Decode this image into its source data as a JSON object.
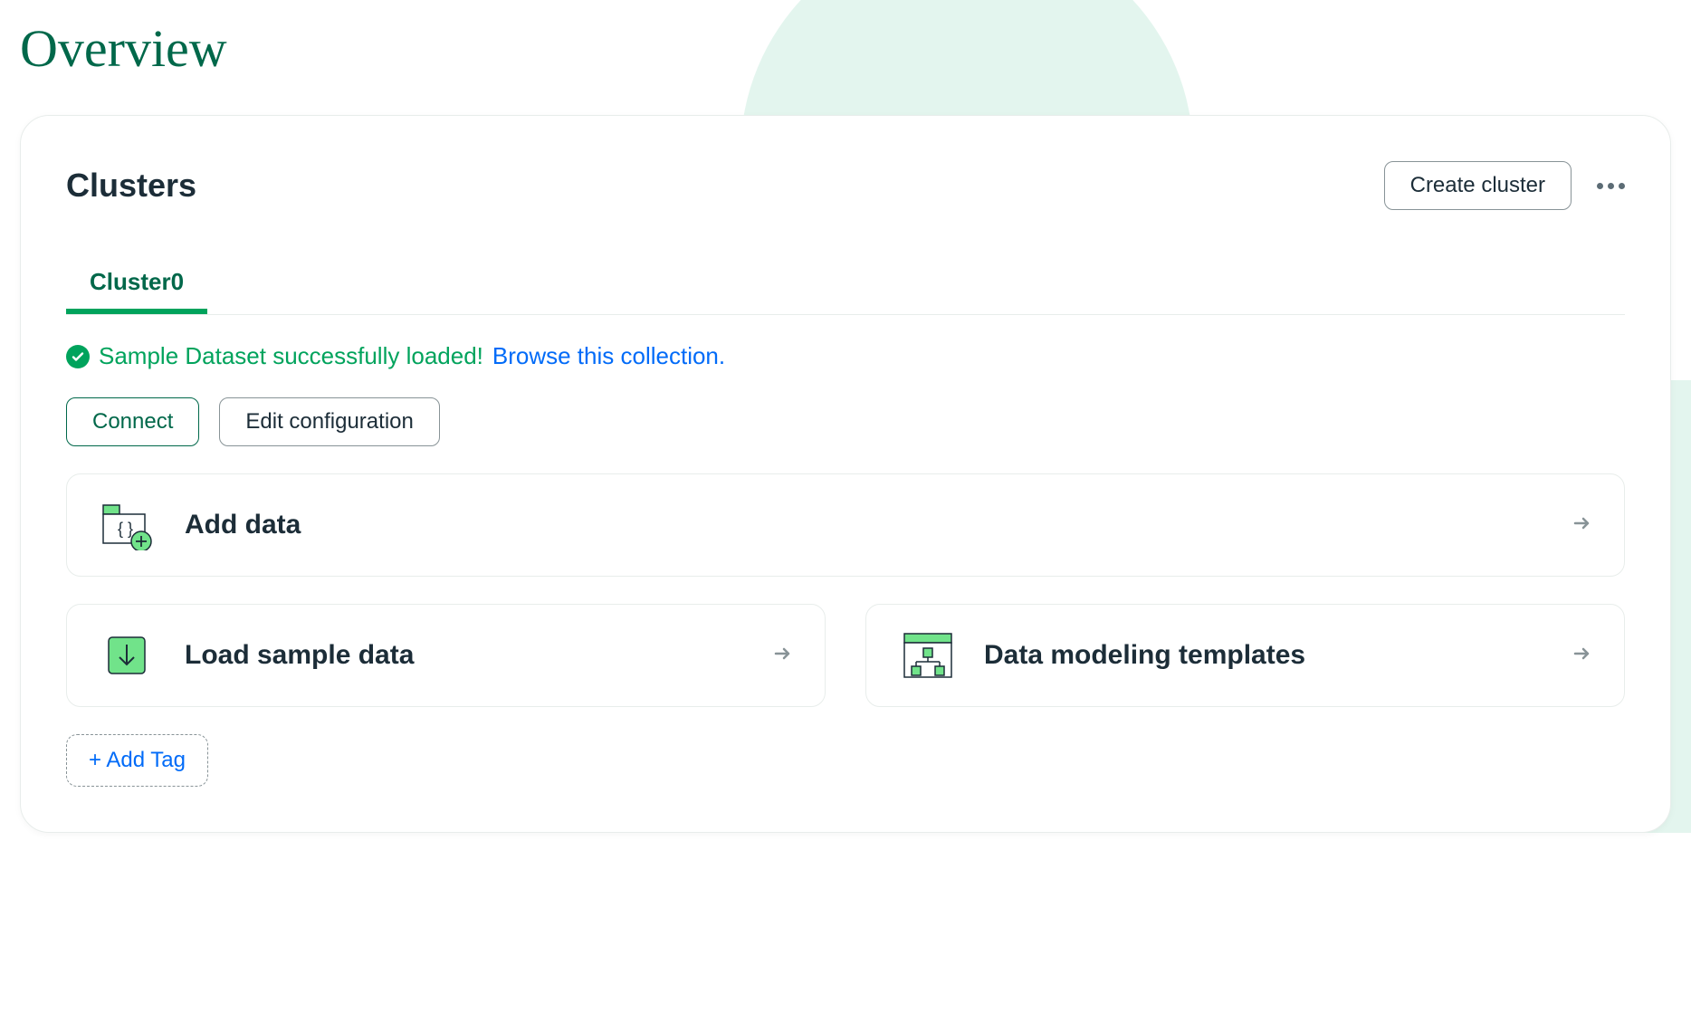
{
  "page": {
    "title": "Overview"
  },
  "panel": {
    "title": "Clusters",
    "create_button": "Create cluster"
  },
  "tabs": [
    {
      "label": "Cluster0"
    }
  ],
  "status": {
    "message": "Sample Dataset successfully loaded!",
    "link": "Browse this collection."
  },
  "buttons": {
    "connect": "Connect",
    "edit_config": "Edit configuration"
  },
  "cards": {
    "add_data": "Add data",
    "load_sample": "Load sample data",
    "templates": "Data modeling templates"
  },
  "add_tag": "+ Add Tag"
}
